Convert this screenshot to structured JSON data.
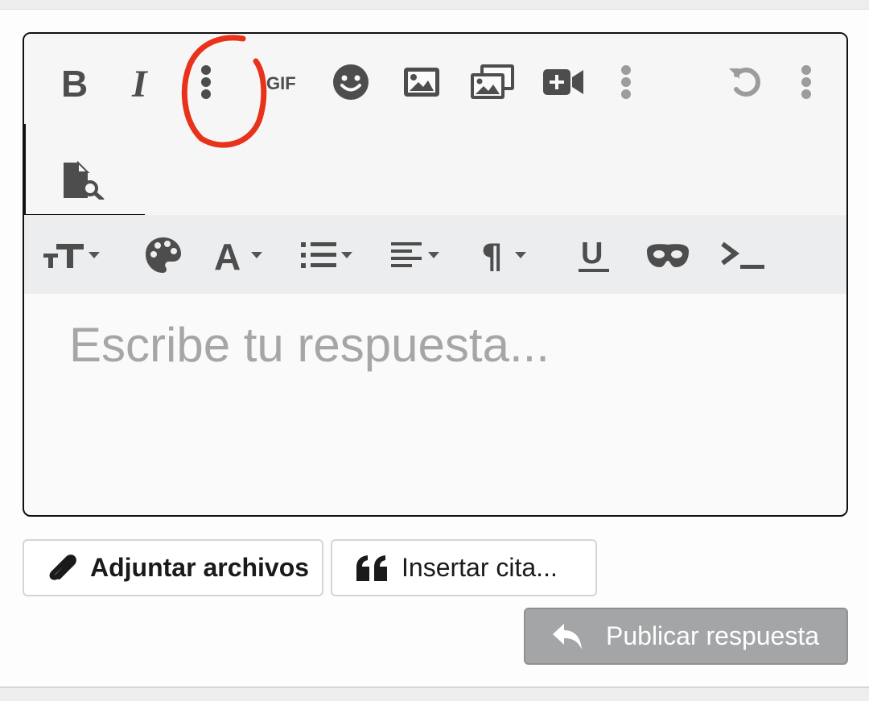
{
  "editor": {
    "placeholder": "Escribe tu respuesta..."
  },
  "toolbar": {
    "buttons": [
      {
        "name": "bold",
        "label": "B"
      },
      {
        "name": "italic",
        "label": "I"
      },
      {
        "name": "more-options"
      },
      {
        "name": "gif",
        "label": "GIF"
      },
      {
        "name": "emoji"
      },
      {
        "name": "insert-image"
      },
      {
        "name": "media-gallery"
      },
      {
        "name": "insert-video"
      },
      {
        "name": "more-options"
      },
      {
        "name": "undo"
      },
      {
        "name": "more-options"
      },
      {
        "name": "preview"
      }
    ],
    "format_buttons": [
      {
        "name": "font-size"
      },
      {
        "name": "color-palette"
      },
      {
        "name": "font-style",
        "label": "A"
      },
      {
        "name": "list"
      },
      {
        "name": "align"
      },
      {
        "name": "paragraph",
        "label": "¶"
      },
      {
        "name": "underline",
        "label": "U"
      },
      {
        "name": "spoiler"
      },
      {
        "name": "code"
      }
    ]
  },
  "actions": {
    "attach_label": "Adjuntar archivos",
    "quote_label": "Insertar cita...",
    "publish_label": "Publicar respuesta"
  },
  "colors": {
    "icon": "#4d4d4d",
    "icon_light": "#9c9c9c",
    "annotation": "#e8321c",
    "publish_bg": "#a3a5a6"
  }
}
